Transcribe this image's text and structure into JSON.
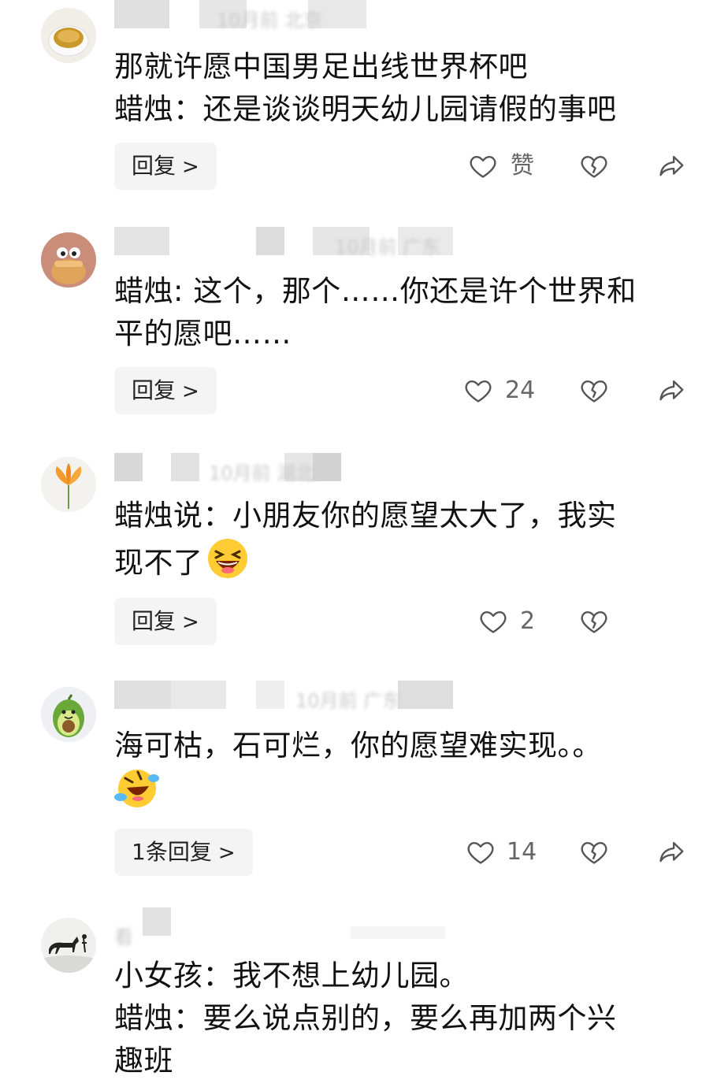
{
  "comments": [
    {
      "blurred_meta": "10月前 北京",
      "lines": [
        "那就许愿中国男足出线世界杯吧",
        "蜡烛：还是谈谈明天幼儿园请假的事吧"
      ],
      "reply_label": "回复",
      "like_label": "赞",
      "avatar": "tea-cup-avatar"
    },
    {
      "blurred_meta": "10月前 广东",
      "lines": [
        "蜡烛: 这个，那个……你还是许个世界和",
        "平的愿吧……"
      ],
      "reply_label": "回复",
      "like_label": "24",
      "avatar": "cartoon-face-avatar"
    },
    {
      "blurred_meta": "10月前 湖北",
      "lines": [
        "蜡烛说：小朋友你的愿望太大了，我实",
        "现不了"
      ],
      "emoji": "laughing-emoji",
      "reply_label": "回复",
      "like_label": "2",
      "avatar": "lily-flower-avatar"
    },
    {
      "blurred_meta": "10月前 广东",
      "lines": [
        "海可枯，石可烂，你的愿望难实现。。"
      ],
      "emoji": "rolling-laugh-emoji",
      "reply_label": "1条回复",
      "like_label": "14",
      "avatar": "avocado-avatar"
    },
    {
      "blurred_meta": "看",
      "lines": [
        "小女孩：我不想上幼儿园。",
        "蜡烛：要么说点别的，要么再加两个兴",
        "趣班"
      ],
      "avatar": "ink-horse-avatar"
    }
  ],
  "icons": [
    "heart-outline-icon",
    "broken-heart-icon",
    "share-arrow-icon",
    "chevron-right-icon"
  ],
  "colors": {
    "text": "#111111",
    "button_bg": "#f4f4f4",
    "meta": "#c9c9c9",
    "icon": "#555555"
  }
}
